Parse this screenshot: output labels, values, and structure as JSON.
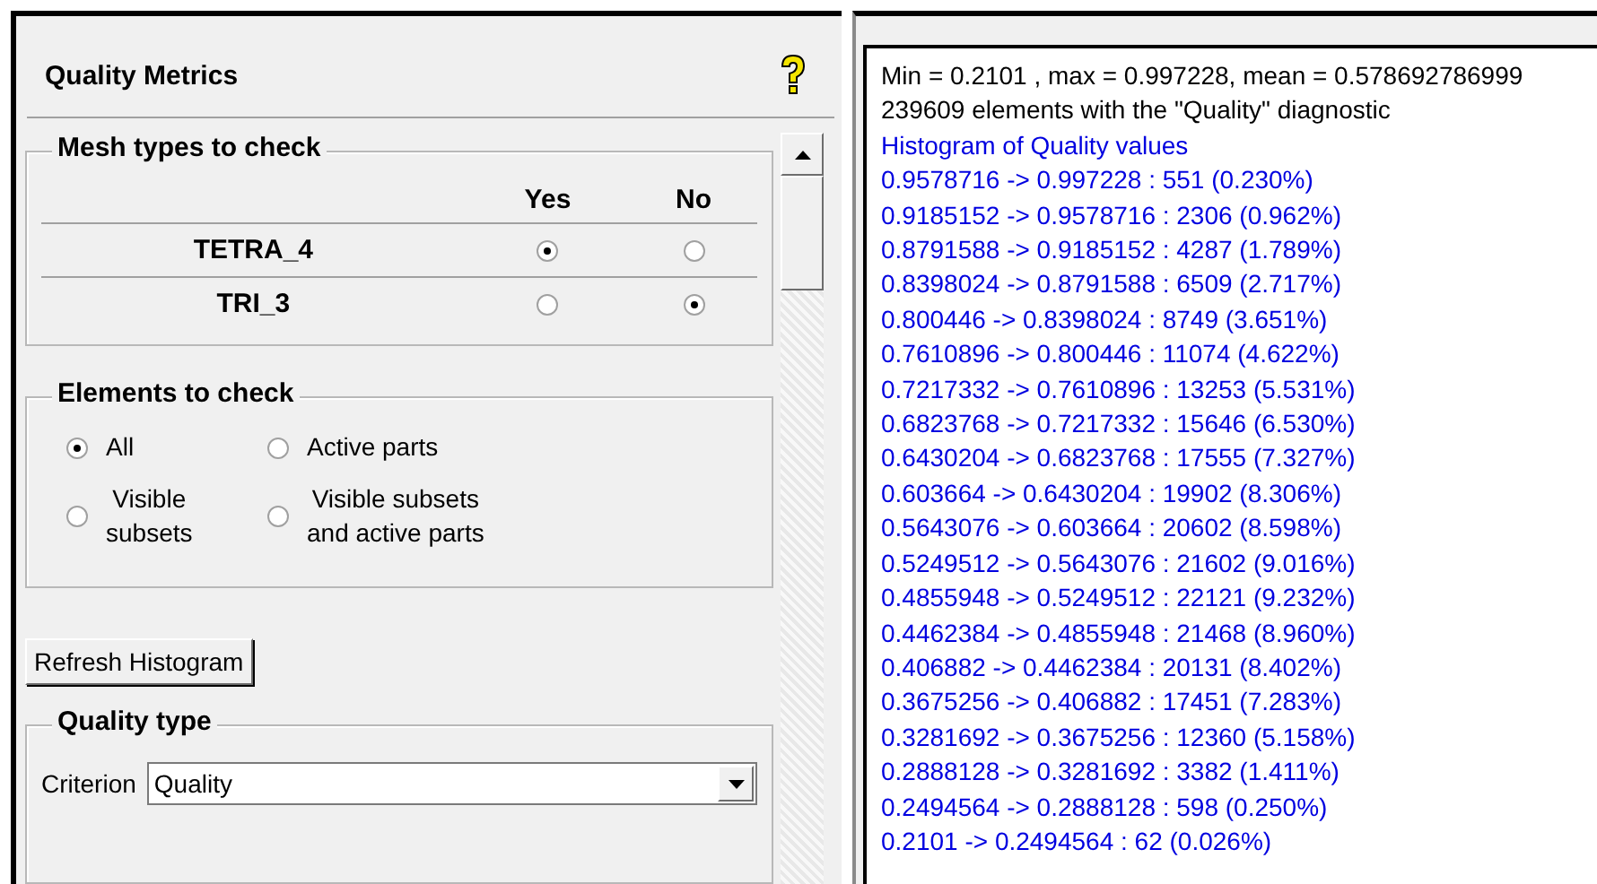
{
  "panel": {
    "title": "Quality Metrics"
  },
  "mesh_types": {
    "title": "Mesh types to check",
    "columns": [
      "Yes",
      "No"
    ],
    "rows": [
      {
        "name": "TETRA_4",
        "choices": [
          {
            "selected": true
          },
          {
            "selected": false
          }
        ]
      },
      {
        "name": "TRI_3",
        "choices": [
          {
            "selected": false
          },
          {
            "selected": true
          }
        ]
      }
    ]
  },
  "elements": {
    "title": "Elements to check",
    "options": [
      {
        "label": "All",
        "selected": true
      },
      {
        "label": "Active parts",
        "selected": false
      },
      {
        "label": "Visible\nsubsets",
        "selected": false
      },
      {
        "label": "Visible subsets\nand active parts",
        "selected": false
      }
    ]
  },
  "refresh_button": "Refresh Histogram",
  "quality_type": {
    "title": "Quality type",
    "criterion_label": "Criterion",
    "criterion_value": "Quality"
  },
  "output": {
    "summary": [
      "Min = 0.2101 , max = 0.997228, mean = 0.578692786999",
      "239609 elements with the \"Quality\" diagnostic"
    ],
    "histogram_title": "Histogram of Quality values",
    "bins": [
      "0.9578716 -> 0.997228 : 551 (0.230%)",
      "0.9185152 -> 0.9578716 : 2306 (0.962%)",
      "0.8791588 -> 0.9185152 : 4287 (1.789%)",
      "0.8398024 -> 0.8791588 : 6509 (2.717%)",
      "0.800446 -> 0.8398024 : 8749 (3.651%)",
      "0.7610896 -> 0.800446 : 11074 (4.622%)",
      "0.7217332 -> 0.7610896 : 13253 (5.531%)",
      "0.6823768 -> 0.7217332 : 15646 (6.530%)",
      "0.6430204 -> 0.6823768 : 17555 (7.327%)",
      "0.603664 -> 0.6430204 : 19902 (8.306%)",
      "0.5643076 -> 0.603664 : 20602 (8.598%)",
      "0.5249512 -> 0.5643076 : 21602 (9.016%)",
      "0.4855948 -> 0.5249512 : 22121 (9.232%)",
      "0.4462384 -> 0.4855948 : 21468 (8.960%)",
      "0.406882 -> 0.4462384 : 20131 (8.402%)",
      "0.3675256 -> 0.406882 : 17451 (7.283%)",
      "0.3281692 -> 0.3675256 : 12360 (5.158%)",
      "0.2888128 -> 0.3281692 : 3382 (1.411%)",
      "0.2494564 -> 0.2888128 : 598 (0.250%)",
      "0.2101 -> 0.2494564 : 62 (0.026%)"
    ]
  }
}
